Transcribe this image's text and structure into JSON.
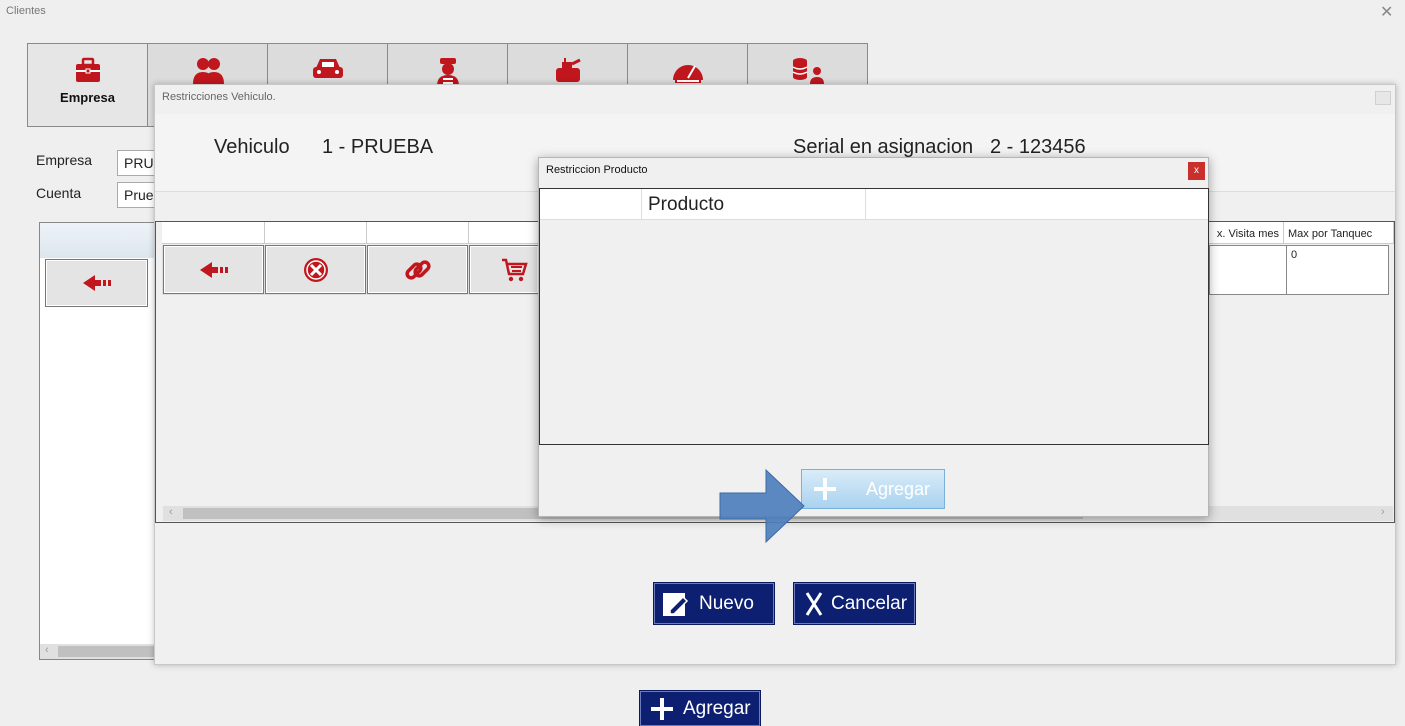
{
  "window": {
    "title": "Clientes",
    "close_glyph": "✕"
  },
  "tabs": [
    {
      "label": "Empresa",
      "icon": "briefcase-icon"
    },
    {
      "label": "",
      "icon": "users-icon"
    },
    {
      "label": "",
      "icon": "car-icon"
    },
    {
      "label": "",
      "icon": "driver-icon"
    },
    {
      "label": "",
      "icon": "fuel-pump-icon"
    },
    {
      "label": "",
      "icon": "speedometer-icon"
    },
    {
      "label": "",
      "icon": "database-user-icon"
    }
  ],
  "form": {
    "empresa_label": "Empresa",
    "empresa_value": "PRU",
    "cuenta_label": "Cuenta",
    "cuenta_value": "Prue"
  },
  "bottom": {
    "agregar_label": "Agregar"
  },
  "restricciones_vehiculo": {
    "title": "Restricciones Vehiculo.",
    "vehiculo_label": "Vehiculo",
    "vehiculo_value": "1 - PRUEBA",
    "serial_label": "Serial en asignacion",
    "serial_value": "2 - 123456",
    "grid": {
      "columns_visible": [
        "x. Visita mes",
        "Max por Tanquec"
      ],
      "row_values": [
        "",
        "0"
      ]
    },
    "nuevo_label": "Nuevo",
    "cancelar_label": "Cancelar"
  },
  "restriccion_producto": {
    "title": "Restriccion Producto",
    "close_glyph": "x",
    "column_header": "Producto",
    "agregar_label": "Agregar"
  },
  "colors": {
    "accent_red": "#c0161d",
    "dark_button": "#0c1f70",
    "close_red": "#c9302c",
    "arrow_blue": "#4f7fbd"
  }
}
